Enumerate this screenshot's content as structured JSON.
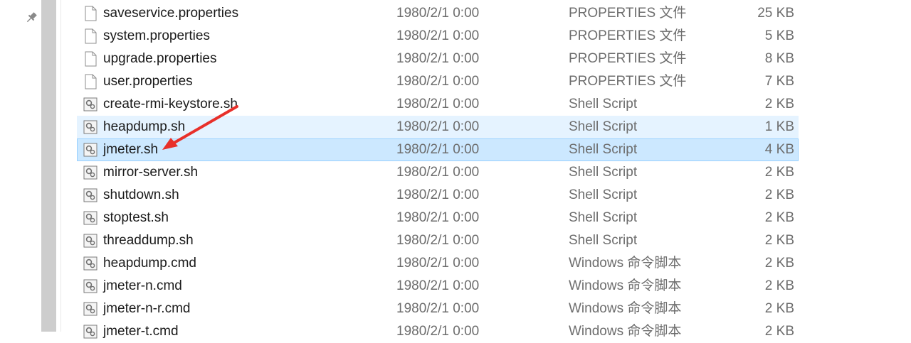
{
  "colors": {
    "selection": "#cce8ff",
    "selection_border": "#99d1ff",
    "hover": "#e5f3ff",
    "annotation_arrow": "#e8302a"
  },
  "files": [
    {
      "name": "saveservice.properties",
      "date": "1980/2/1 0:00",
      "type": "PROPERTIES 文件",
      "size": "25 KB",
      "icon": "document-icon"
    },
    {
      "name": "system.properties",
      "date": "1980/2/1 0:00",
      "type": "PROPERTIES 文件",
      "size": "5 KB",
      "icon": "document-icon"
    },
    {
      "name": "upgrade.properties",
      "date": "1980/2/1 0:00",
      "type": "PROPERTIES 文件",
      "size": "8 KB",
      "icon": "document-icon"
    },
    {
      "name": "user.properties",
      "date": "1980/2/1 0:00",
      "type": "PROPERTIES 文件",
      "size": "7 KB",
      "icon": "document-icon"
    },
    {
      "name": "create-rmi-keystore.sh",
      "date": "1980/2/1 0:00",
      "type": "Shell Script",
      "size": "2 KB",
      "icon": "script-icon"
    },
    {
      "name": "heapdump.sh",
      "date": "1980/2/1 0:00",
      "type": "Shell Script",
      "size": "1 KB",
      "icon": "script-icon",
      "state": "hover"
    },
    {
      "name": "jmeter.sh",
      "date": "1980/2/1 0:00",
      "type": "Shell Script",
      "size": "4 KB",
      "icon": "script-icon",
      "state": "selected"
    },
    {
      "name": "mirror-server.sh",
      "date": "1980/2/1 0:00",
      "type": "Shell Script",
      "size": "2 KB",
      "icon": "script-icon"
    },
    {
      "name": "shutdown.sh",
      "date": "1980/2/1 0:00",
      "type": "Shell Script",
      "size": "2 KB",
      "icon": "script-icon"
    },
    {
      "name": "stoptest.sh",
      "date": "1980/2/1 0:00",
      "type": "Shell Script",
      "size": "2 KB",
      "icon": "script-icon"
    },
    {
      "name": "threaddump.sh",
      "date": "1980/2/1 0:00",
      "type": "Shell Script",
      "size": "2 KB",
      "icon": "script-icon"
    },
    {
      "name": "heapdump.cmd",
      "date": "1980/2/1 0:00",
      "type": "Windows 命令脚本",
      "size": "2 KB",
      "icon": "script-icon"
    },
    {
      "name": "jmeter-n.cmd",
      "date": "1980/2/1 0:00",
      "type": "Windows 命令脚本",
      "size": "2 KB",
      "icon": "script-icon"
    },
    {
      "name": "jmeter-n-r.cmd",
      "date": "1980/2/1 0:00",
      "type": "Windows 命令脚本",
      "size": "2 KB",
      "icon": "script-icon"
    },
    {
      "name": "jmeter-t.cmd",
      "date": "1980/2/1 0:00",
      "type": "Windows 命令脚本",
      "size": "2 KB",
      "icon": "script-icon"
    }
  ]
}
